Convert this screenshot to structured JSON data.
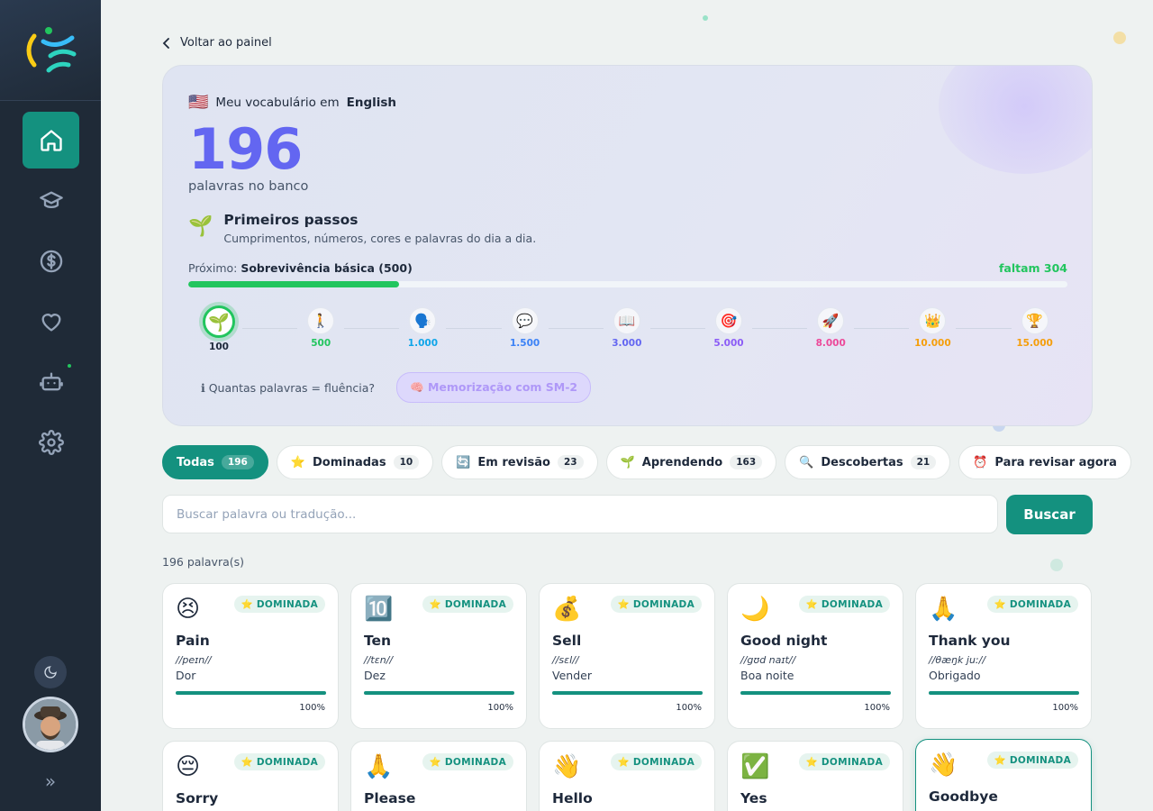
{
  "app": {
    "back_label": "Voltar ao painel"
  },
  "sidebar": {
    "items": [
      {
        "icon": "home-icon",
        "active": true
      },
      {
        "icon": "graduation-cap-icon"
      },
      {
        "icon": "dollar-icon"
      },
      {
        "icon": "heart-icon"
      },
      {
        "icon": "robot-icon"
      },
      {
        "icon": "gear-icon"
      }
    ]
  },
  "hero": {
    "flag": "🇺🇸",
    "title_prefix": "Meu vocabulário em",
    "language": "English",
    "word_count": "196",
    "word_count_label": "palavras no banco",
    "level_icon": "🌱",
    "level_name": "Primeiros passos",
    "level_desc": "Cumprimentos, números, cores e palavras do dia a dia.",
    "next_prefix": "Próximo:",
    "next_level": "Sobrevivência básica (500)",
    "remaining": "faltam 304",
    "progress": 0.24,
    "milestones": [
      {
        "icon": "🌱",
        "label": "100",
        "color": "#1e293b",
        "current": true
      },
      {
        "icon": "🚶",
        "label": "500",
        "color": "#22c55e"
      },
      {
        "icon": "🗣️",
        "label": "1.000",
        "color": "#0ea5e9"
      },
      {
        "icon": "💬",
        "label": "1.500",
        "color": "#3b82f6"
      },
      {
        "icon": "📖",
        "label": "3.000",
        "color": "#6366f1"
      },
      {
        "icon": "🎯",
        "label": "5.000",
        "color": "#8b5cf6"
      },
      {
        "icon": "🚀",
        "label": "8.000",
        "color": "#ec4899"
      },
      {
        "icon": "👑",
        "label": "10.000",
        "color": "#f59e0b"
      },
      {
        "icon": "🏆",
        "label": "15.000",
        "color": "#f59e0b"
      }
    ],
    "info_link": "ℹ Quantas palavras = fluência?",
    "sm2_label": "🧠 Memorização com SM-2"
  },
  "filters": [
    {
      "icon": "",
      "label": "Todas",
      "count": "196",
      "active": true
    },
    {
      "icon": "⭐",
      "label": "Dominadas",
      "count": "10"
    },
    {
      "icon": "🔄",
      "label": "Em revisão",
      "count": "23"
    },
    {
      "icon": "🌱",
      "label": "Aprendendo",
      "count": "163"
    },
    {
      "icon": "🔍",
      "label": "Descobertas",
      "count": "21"
    },
    {
      "icon": "⏰",
      "label": "Para revisar agora",
      "count": ""
    }
  ],
  "search": {
    "placeholder": "Buscar palavra ou tradução...",
    "button": "Buscar"
  },
  "results_count": "196 palavra(s)",
  "badge_label": "⭐ DOMINADA",
  "cards": [
    {
      "emoji": "😣",
      "word": "Pain",
      "ipa": "//peɪn//",
      "translation": "Dor",
      "progress": "100%"
    },
    {
      "emoji": "🔟",
      "word": "Ten",
      "ipa": "//tɛn//",
      "translation": "Dez",
      "progress": "100%"
    },
    {
      "emoji": "💰",
      "word": "Sell",
      "ipa": "//sɛl//",
      "translation": "Vender",
      "progress": "100%"
    },
    {
      "emoji": "🌙",
      "word": "Good night",
      "ipa": "//gʊd naɪt//",
      "translation": "Boa noite",
      "progress": "100%"
    },
    {
      "emoji": "🙏",
      "word": "Thank you",
      "ipa": "//θæŋk juː//",
      "translation": "Obrigado",
      "progress": "100%"
    },
    {
      "emoji": "😔",
      "word": "Sorry",
      "ipa": "",
      "translation": "",
      "progress": ""
    },
    {
      "emoji": "🙏",
      "word": "Please",
      "ipa": "",
      "translation": "",
      "progress": ""
    },
    {
      "emoji": "👋",
      "word": "Hello",
      "ipa": "",
      "translation": "",
      "progress": ""
    },
    {
      "emoji": "✅",
      "word": "Yes",
      "ipa": "",
      "translation": "",
      "progress": ""
    },
    {
      "emoji": "👋",
      "word": "Goodbye",
      "ipa": "",
      "translation": "",
      "progress": ""
    }
  ],
  "colors": {
    "accent": "#14917f",
    "sidebar_bg": "#1f2a37",
    "progress_green": "#22c55e",
    "number_purple": "#6366f1"
  }
}
